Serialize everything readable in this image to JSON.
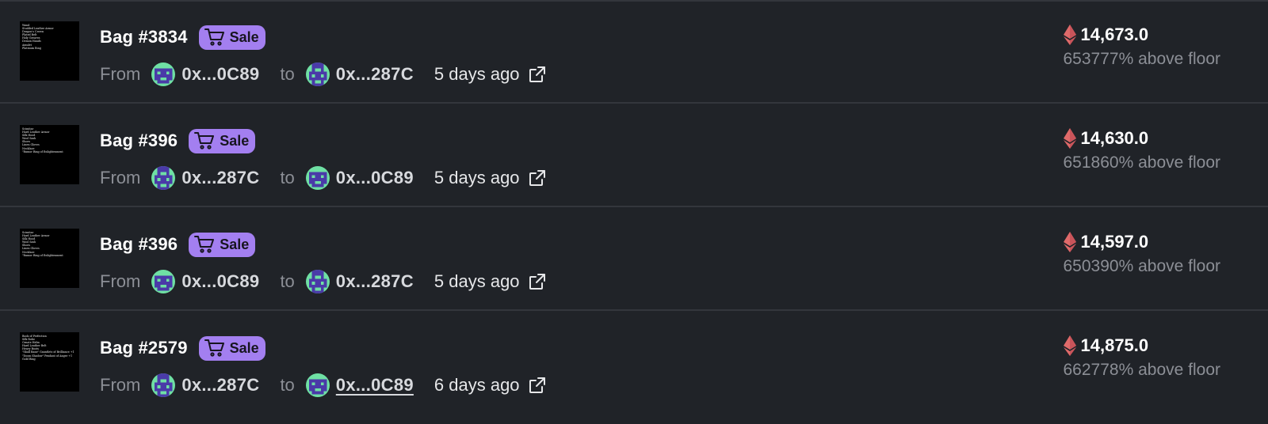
{
  "colors": {
    "background": "#202328",
    "divider": "#33363c",
    "sale_badge": "#a37ff0",
    "eth": "#e06a6a",
    "muted_text": "#8c8f96"
  },
  "labels": {
    "from": "From",
    "to": "to",
    "sale": "Sale"
  },
  "icons": {
    "cart": "cart-icon",
    "avatar": "pixel-avatar",
    "external_link": "external-link-icon",
    "eth": "ethereum-icon"
  },
  "rows": [
    {
      "bag": "Bag #3834",
      "thumb_lines": [
        "Wand",
        "Studded Leather Armor",
        "Dragon's Crown",
        "Plated Belt",
        "Holy Greaves",
        "Demon Hands",
        "Amulet",
        "Platinum Ring"
      ],
      "from_addr": "0x...0C89",
      "to_addr": "0x...287C",
      "time": "5 days ago",
      "price": "14,673.0",
      "floor": "653777% above floor"
    },
    {
      "bag": "Bag #396",
      "thumb_lines": [
        "Scimitar",
        "Hard Leather Armor",
        "Silk Hood",
        "Wool Sash",
        "Shoes",
        "Linen Gloves",
        "Necklace",
        "\"Rumor Ring of Enlightenment"
      ],
      "from_addr": "0x...287C",
      "to_addr": "0x...0C89",
      "time": "5 days ago",
      "price": "14,630.0",
      "floor": "651860% above floor"
    },
    {
      "bag": "Bag #396",
      "thumb_lines": [
        "Scimitar",
        "Hard Leather Armor",
        "Silk Hood",
        "Wool Sash",
        "Shoes",
        "Linen Gloves",
        "Necklace",
        "\"Rumor Ring of Enlightenment"
      ],
      "from_addr": "0x...0C89",
      "to_addr": "0x...287C",
      "time": "5 days ago",
      "price": "14,597.0",
      "floor": "650390% above floor"
    },
    {
      "bag": "Bag #2579",
      "thumb_lines": [
        "Book of Perfection",
        "Silk Robe",
        "Ornate Helm",
        "Hard Leather Belt",
        "Heavy Boots",
        "\"Skull Bane\" Gauntlets of Brilliance +1",
        "\"Doom Shadow\" Pendant of Anger +1",
        "Gold Ring"
      ],
      "from_addr": "0x...287C",
      "to_addr": "0x...0C89",
      "time": "6 days ago",
      "price": "14,875.0",
      "floor": "662778% above floor"
    }
  ]
}
